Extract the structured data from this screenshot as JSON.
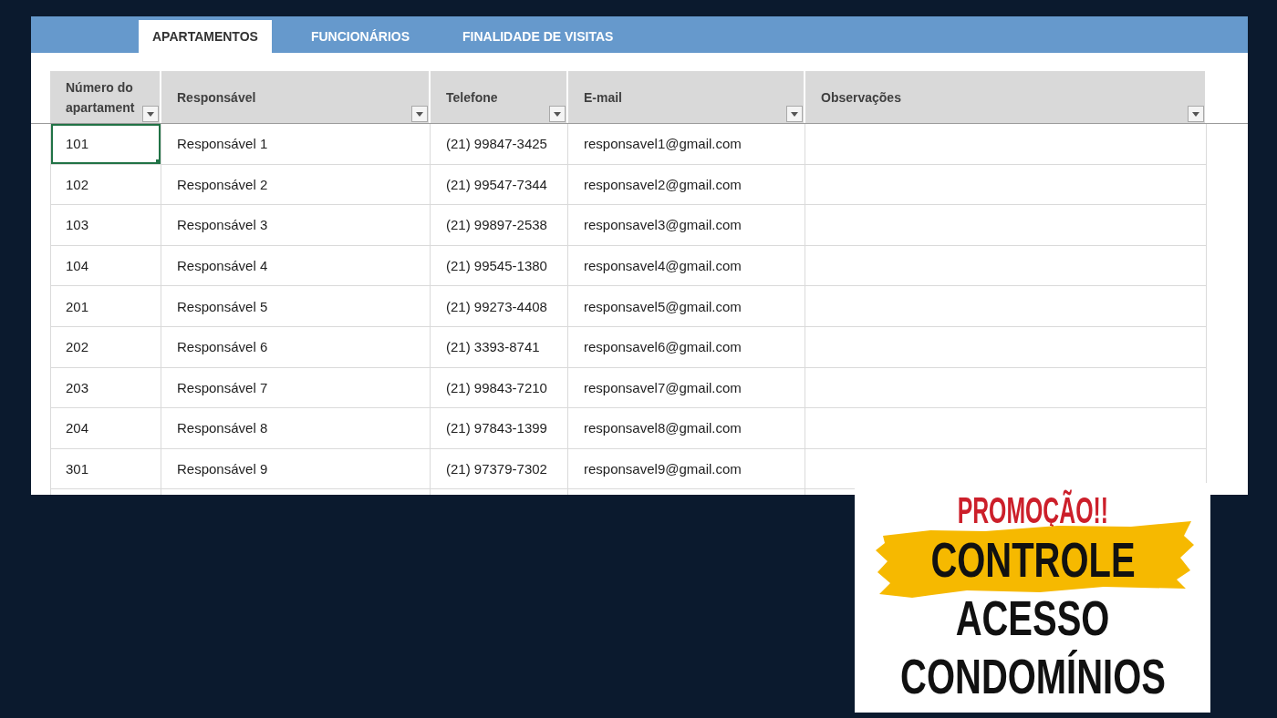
{
  "tabs": [
    {
      "label": "APARTAMENTOS",
      "selected": true
    },
    {
      "label": "FUNCIONÁRIOS",
      "selected": false
    },
    {
      "label": "FINALIDADE DE VISITAS",
      "selected": false
    }
  ],
  "table": {
    "columns": [
      {
        "label": "Número do apartament"
      },
      {
        "label": "Responsável"
      },
      {
        "label": "Telefone"
      },
      {
        "label": "E-mail"
      },
      {
        "label": "Observações"
      }
    ],
    "rows": [
      {
        "cells": [
          {
            "text": "101",
            "selected": true
          },
          {
            "text": "Responsável 1",
            "selected": false
          },
          {
            "text": "(21) 99847-3425",
            "selected": false
          },
          {
            "text": "responsavel1@gmail.com",
            "selected": false
          }
        ]
      },
      {
        "cells": [
          {
            "text": "102",
            "selected": false
          },
          {
            "text": "Responsável 2",
            "selected": false
          },
          {
            "text": "(21) 99547-7344",
            "selected": false
          },
          {
            "text": "responsavel2@gmail.com",
            "selected": false
          }
        ]
      },
      {
        "cells": [
          {
            "text": "103",
            "selected": false
          },
          {
            "text": "Responsável 3",
            "selected": false
          },
          {
            "text": "(21) 99897-2538",
            "selected": false
          },
          {
            "text": "responsavel3@gmail.com",
            "selected": false
          }
        ]
      },
      {
        "cells": [
          {
            "text": "104",
            "selected": false
          },
          {
            "text": "Responsável 4",
            "selected": false
          },
          {
            "text": "(21) 99545-1380",
            "selected": false
          },
          {
            "text": "responsavel4@gmail.com",
            "selected": false
          }
        ]
      },
      {
        "cells": [
          {
            "text": "201",
            "selected": false
          },
          {
            "text": "Responsável 5",
            "selected": false
          },
          {
            "text": "(21) 99273-4408",
            "selected": false
          },
          {
            "text": "responsavel5@gmail.com",
            "selected": false
          }
        ]
      },
      {
        "cells": [
          {
            "text": "202",
            "selected": false
          },
          {
            "text": "Responsável 6",
            "selected": false
          },
          {
            "text": "(21) 3393-8741",
            "selected": false
          },
          {
            "text": "responsavel6@gmail.com",
            "selected": false
          }
        ]
      },
      {
        "cells": [
          {
            "text": "203",
            "selected": false
          },
          {
            "text": "Responsável 7",
            "selected": false
          },
          {
            "text": "(21) 99843-7210",
            "selected": false
          },
          {
            "text": "responsavel7@gmail.com",
            "selected": false
          }
        ]
      },
      {
        "cells": [
          {
            "text": "204",
            "selected": false
          },
          {
            "text": "Responsável 8",
            "selected": false
          },
          {
            "text": "(21) 97843-1399",
            "selected": false
          },
          {
            "text": "responsavel8@gmail.com",
            "selected": false
          }
        ]
      },
      {
        "cells": [
          {
            "text": "301",
            "selected": false
          },
          {
            "text": "Responsável 9",
            "selected": false
          },
          {
            "text": "(21) 97379-7302",
            "selected": false
          },
          {
            "text": "responsavel9@gmail.com",
            "selected": false
          }
        ]
      }
    ]
  },
  "promo": {
    "headline": "PROMOÇÃO!!",
    "lines": [
      {
        "text": "CONTROLE",
        "highlighted": true
      },
      {
        "text": "ACESSO",
        "highlighted": false
      },
      {
        "text": "CONDOMÍNIOS",
        "highlighted": false
      }
    ]
  }
}
